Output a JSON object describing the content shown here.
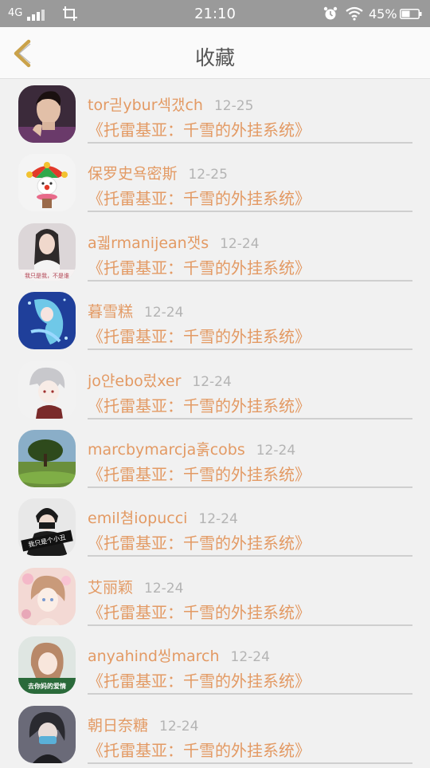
{
  "status_bar": {
    "network": "4G",
    "time": "21:10",
    "battery": "45%"
  },
  "header": {
    "title": "收藏"
  },
  "items": [
    {
      "user": "tor긛ybur섹갰ch",
      "date": "12-25",
      "book": "《托雷基亚：千雪的外挂系统》"
    },
    {
      "user": "保罗史욕密斯",
      "date": "12-25",
      "book": "《托雷基亚：千雪的外挂系统》"
    },
    {
      "user": "a궯rmanijean잿s",
      "date": "12-24",
      "book": "《托雷基亚：千雪的外挂系统》"
    },
    {
      "user": "暮雪糕",
      "date": "12-24",
      "book": "《托雷基亚：千雪的外挂系统》"
    },
    {
      "user": "jo얀ebo렀xer",
      "date": "12-24",
      "book": "《托雷基亚：千雪的外挂系统》"
    },
    {
      "user": "marcbymarcja훍cobs",
      "date": "12-24",
      "book": "《托雷基亚：千雪的外挂系统》"
    },
    {
      "user": "emil쳠iopucci",
      "date": "12-24",
      "book": "《托雷基亚：千雪的外挂系统》"
    },
    {
      "user": "艾丽颖",
      "date": "12-24",
      "book": "《托雷基亚：千雪的外挂系统》"
    },
    {
      "user": "anyahind씽march",
      "date": "12-24",
      "book": "《托雷基亚：千雪的外挂系统》"
    },
    {
      "user": "朝日奈糖",
      "date": "12-24",
      "book": "《托雷基亚：千雪的外挂系统》"
    }
  ],
  "avatars": [
    {
      "icon": "man-portrait-avatar",
      "bg": "#3b2a3a",
      "fg": "#e2c0a8"
    },
    {
      "icon": "clown-avatar",
      "bg": "#f4f4f4",
      "fg": "#e23a2a"
    },
    {
      "icon": "girl-photo-avatar",
      "bg": "#dcd6d8",
      "fg": "#2e2a2a",
      "caption": "我只是我，不是谁"
    },
    {
      "icon": "anime-mermaid-avatar",
      "bg": "#1f3f9a",
      "fg": "#6fc8e8"
    },
    {
      "icon": "anime-white-hair-avatar",
      "bg": "#f2f2f2",
      "fg": "#c8c8cc"
    },
    {
      "icon": "tree-landscape-avatar",
      "bg": "#6a8f3c",
      "fg": "#2e4a1c"
    },
    {
      "icon": "masked-person-avatar",
      "bg": "#e8e8e8",
      "fg": "#1b1b1b",
      "caption": "我只是个小丑"
    },
    {
      "icon": "anime-girl-flowers-avatar",
      "bg": "#f3d9d4",
      "fg": "#c99a7a"
    },
    {
      "icon": "girl-selfie-avatar",
      "bg": "#dfe6e2",
      "fg": "#b88868",
      "caption": "去你妈的爱情"
    },
    {
      "icon": "masked-girl-avatar",
      "bg": "#6a6a78",
      "fg": "#2a2a30"
    }
  ]
}
